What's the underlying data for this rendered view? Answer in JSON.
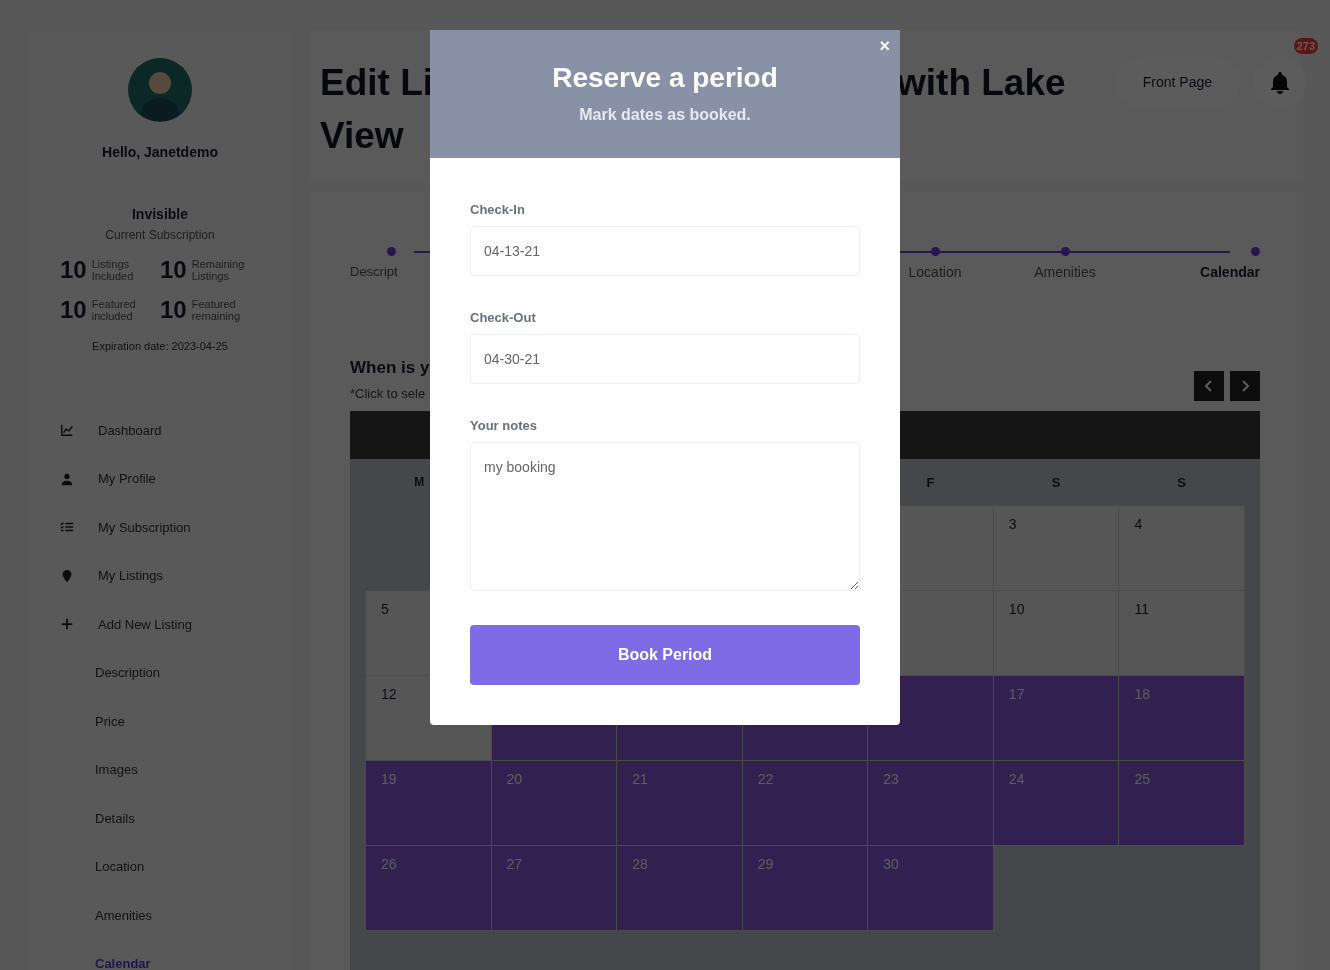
{
  "sidebar": {
    "greeting": "Hello, Janetdemo",
    "plan": "Invisible",
    "plan_caption": "Current Subscription",
    "stats": [
      {
        "value": "10",
        "label": "Listings Included"
      },
      {
        "value": "10",
        "label": "Remaining Listings"
      },
      {
        "value": "10",
        "label": "Featured included"
      },
      {
        "value": "10",
        "label": "Featured remaining"
      }
    ],
    "expiration": "Expiration date: 2023-04-25",
    "items": [
      {
        "label": "Dashboard",
        "selected": false
      },
      {
        "label": "My Profile",
        "selected": false
      },
      {
        "label": "My Subscription",
        "selected": false
      },
      {
        "label": "My Listings",
        "selected": false
      },
      {
        "label": "Add New Listing",
        "selected": false,
        "children": [
          {
            "label": "Description",
            "selected": false
          },
          {
            "label": "Price",
            "selected": false
          },
          {
            "label": "Images",
            "selected": false
          },
          {
            "label": "Details",
            "selected": false
          },
          {
            "label": "Location",
            "selected": false
          },
          {
            "label": "Amenities",
            "selected": false
          },
          {
            "label": "Calendar",
            "selected": true
          }
        ]
      }
    ]
  },
  "header": {
    "title_left": "Edit Li",
    "title_right": "with Lake",
    "title_line2": "View",
    "front_page": "Front Page",
    "notifications": "273"
  },
  "steps": [
    {
      "kind": "step",
      "label": "Descript",
      "selected": false
    },
    {
      "kind": "covered"
    },
    {
      "kind": "covered"
    },
    {
      "kind": "covered"
    },
    {
      "kind": "step",
      "label": "Location",
      "selected": false
    },
    {
      "kind": "step",
      "label": "Amenities",
      "selected": false
    },
    {
      "kind": "step",
      "label": "Calendar",
      "selected": true
    }
  ],
  "calendar": {
    "heading": "When is y",
    "hint": "*Click to sele",
    "weekdays": [
      {
        "kind": "label",
        "label": "M"
      },
      {
        "kind": "covered"
      },
      {
        "kind": "covered"
      },
      {
        "kind": "covered"
      },
      {
        "kind": "label",
        "label": "F"
      },
      {
        "kind": "label",
        "label": "S"
      },
      {
        "kind": "label",
        "label": "S"
      }
    ],
    "weeks": [
      [
        {
          "kind": "blank"
        },
        {
          "kind": "blank"
        },
        {
          "kind": "blank"
        },
        {
          "kind": "covered"
        },
        {
          "kind": "day",
          "booked": false
        },
        {
          "kind": "day",
          "day": "3",
          "booked": false
        },
        {
          "kind": "day",
          "day": "4",
          "booked": false
        }
      ],
      [
        {
          "kind": "day",
          "day": "5",
          "booked": false
        },
        {
          "kind": "covered"
        },
        {
          "kind": "covered"
        },
        {
          "kind": "covered"
        },
        {
          "kind": "day",
          "booked": false
        },
        {
          "kind": "day",
          "day": "10",
          "booked": false
        },
        {
          "kind": "day",
          "day": "11",
          "booked": false
        }
      ],
      [
        {
          "kind": "day",
          "day": "12",
          "booked": false
        },
        {
          "kind": "day",
          "booked": true
        },
        {
          "kind": "day",
          "booked": true
        },
        {
          "kind": "day",
          "booked": true
        },
        {
          "kind": "day",
          "booked": true
        },
        {
          "kind": "day",
          "day": "17",
          "booked": true
        },
        {
          "kind": "day",
          "day": "18",
          "booked": true
        }
      ],
      [
        {
          "kind": "day",
          "day": "19",
          "booked": true
        },
        {
          "kind": "day",
          "day": "20",
          "booked": true
        },
        {
          "kind": "day",
          "day": "21",
          "booked": true
        },
        {
          "kind": "day",
          "day": "22",
          "booked": true
        },
        {
          "kind": "day",
          "day": "23",
          "booked": true
        },
        {
          "kind": "day",
          "day": "24",
          "booked": true
        },
        {
          "kind": "day",
          "day": "25",
          "booked": true
        }
      ],
      [
        {
          "kind": "day",
          "day": "26",
          "booked": true
        },
        {
          "kind": "day",
          "day": "27",
          "booked": true
        },
        {
          "kind": "day",
          "day": "28",
          "booked": true
        },
        {
          "kind": "day",
          "day": "29",
          "booked": true
        },
        {
          "kind": "day",
          "day": "30",
          "booked": true
        },
        {
          "kind": "blank"
        },
        {
          "kind": "blank"
        }
      ]
    ]
  },
  "modal": {
    "title": "Reserve a period",
    "subtitle": "Mark dates as booked.",
    "close": "×",
    "fields": [
      {
        "kind": "input",
        "label": "Check-In",
        "value": "04-13-21"
      },
      {
        "kind": "input",
        "label": "Check-Out",
        "value": "04-30-21"
      },
      {
        "kind": "textarea",
        "label": "Your notes",
        "value": "my booking"
      }
    ],
    "button": "Book Period"
  }
}
